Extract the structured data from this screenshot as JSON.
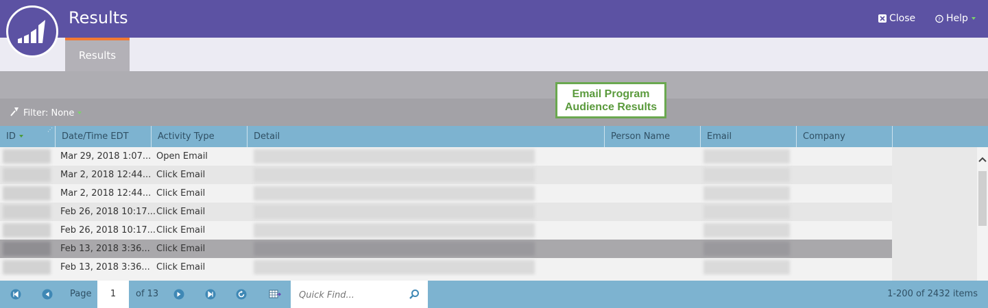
{
  "app": {
    "title": "Results"
  },
  "top_actions": {
    "close_label": "Close",
    "help_label": "Help"
  },
  "tabs": [
    {
      "label": "Results"
    }
  ],
  "filter": {
    "label": "Filter: None"
  },
  "callout": {
    "line1": "Email Program",
    "line2": "Audience Results"
  },
  "table": {
    "columns": [
      "ID",
      "Date/Time EDT",
      "Activity Type",
      "Detail",
      "Person Name",
      "Email",
      "Company"
    ],
    "rows": [
      {
        "date": "Mar 29, 2018 1:07...",
        "activity": "Open Email"
      },
      {
        "date": "Mar 2, 2018 12:44...",
        "activity": "Click Email"
      },
      {
        "date": "Mar 2, 2018 12:44...",
        "activity": "Click Email"
      },
      {
        "date": "Feb 26, 2018 10:17...",
        "activity": "Click Email"
      },
      {
        "date": "Feb 26, 2018 10:17...",
        "activity": "Click Email"
      },
      {
        "date": "Feb 13, 2018 3:36...",
        "activity": "Click Email"
      },
      {
        "date": "Feb 13, 2018 3:36...",
        "activity": "Click Email"
      }
    ],
    "selected_row": 5
  },
  "pager": {
    "page_label": "Page",
    "page_value": "1",
    "of_label": "of 13",
    "quick_find_placeholder": "Quick Find...",
    "items_label": "1-200 of 2432 items"
  },
  "colors": {
    "brand": "#5c52a3",
    "tab_accent": "#f27a33",
    "grid_header": "#7db3d0",
    "callout_green": "#6aa84f"
  }
}
